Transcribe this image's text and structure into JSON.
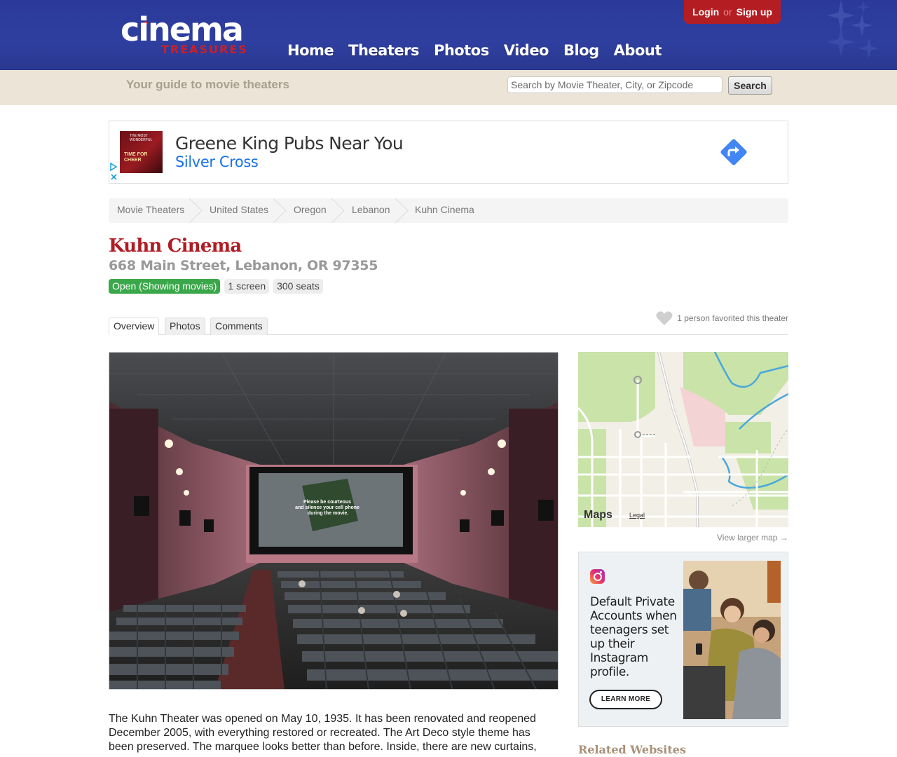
{
  "header": {
    "logo_word": "cinema",
    "logo_sub": "TREASURES",
    "nav": [
      "Home",
      "Theaters",
      "Photos",
      "Video",
      "Blog",
      "About"
    ],
    "login_label": "Login",
    "or_label": "or",
    "signup_label": "Sign up",
    "brand_color": "#2f3f9f",
    "accent_color": "#b41e23"
  },
  "strip": {
    "tagline": "Your guide to movie theaters",
    "search_placeholder": "Search by Movie Theater, City, or Zipcode",
    "search_button": "Search"
  },
  "ad_banner": {
    "headline": "Greene King Pubs Near You",
    "advertiser": "Silver Cross",
    "thumb_line1": "TIME FOR CHEER",
    "thumb_line2": "THE MOST WONDERFUL"
  },
  "breadcrumb": [
    "Movie Theaters",
    "United States",
    "Oregon",
    "Lebanon",
    "Kuhn Cinema"
  ],
  "theater": {
    "name": "Kuhn Cinema",
    "address": "668 Main Street, Lebanon, OR 97355",
    "status": "Open (Showing movies)",
    "screens": "1 screen",
    "seats": "300 seats",
    "status_color": "#3aa84a"
  },
  "tabs": [
    "Overview",
    "Photos",
    "Comments"
  ],
  "favorites_text": "1 person favorited this theater",
  "photo": {
    "screen_text": "Please be courteous and silence your cell phone during the movie."
  },
  "description": "The Kuhn Theater was opened on May 10, 1935. It has been renovated and reopened December 2005, with everything restored or recreated. The Art Deco style theme has been preserved. The marquee looks better than before. Inside, there are new curtains,",
  "map": {
    "brand": "Maps",
    "legal": "Legal",
    "view_larger": "View larger map →"
  },
  "instagram_ad": {
    "text": "Default Private Accounts when teenagers set up their Instagram profile.",
    "button": "LEARN MORE"
  },
  "related_heading": "Related Websites"
}
